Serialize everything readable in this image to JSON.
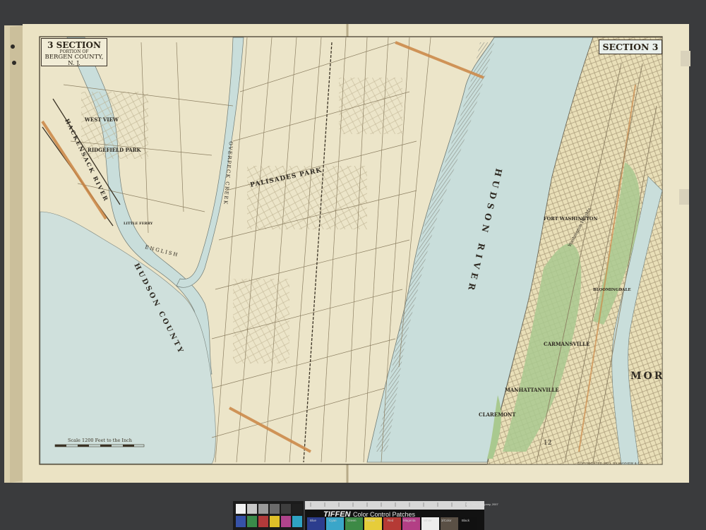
{
  "map": {
    "title_left": {
      "section": "3 SECTION",
      "portion": "PORTION OF",
      "county": "BERGEN COUNTY, N. J."
    },
    "title_right": "SECTION 3",
    "scale": "Scale 1200 Feet to the Inch",
    "copyright": "COPYRIGHTED 1921, BY MAYHEW & CO.",
    "labels": {
      "hudson_river": "HUDSON RIVER",
      "hudson_county": "HUDSON COUNTY",
      "hackensack_river": "HACKENSACK RIVER",
      "overpeck_creek": "OVERPECK CREEK",
      "english_creek": "ENGLISH",
      "west_view": "WEST VIEW",
      "ridgefield_park": "RIDGEFIELD PARK",
      "little_ferry": "LITTLE FERRY",
      "palisades_park": "PALISADES PARK",
      "fort_washington": "FORT WASHINGTON",
      "washington_heights": "Washington Heights",
      "carmansville": "CARMANSVILLE",
      "manhattanville": "MANHATTANVILLE",
      "claremont": "CLAREMONT",
      "bloomingdale": "BLOOMINGDALE",
      "mor": "MOR",
      "ward_12": "12"
    }
  },
  "color_target": {
    "brand": "TIFFEN",
    "subtitle": "Color Control Patches",
    "trademark": "© The Tiffen Company, 2007",
    "patch_names": [
      "Blue",
      "Cyan",
      "Green",
      "Yellow",
      "Red",
      "Magenta",
      "White",
      "3/Color",
      "Black"
    ]
  },
  "colors": {
    "paper": "#ece5c9",
    "water": "#c9dedb",
    "park_green": "#a9c98f",
    "road_orange": "#cc8a4a",
    "ink": "#2f2a22",
    "background": "#3a3b3d"
  }
}
